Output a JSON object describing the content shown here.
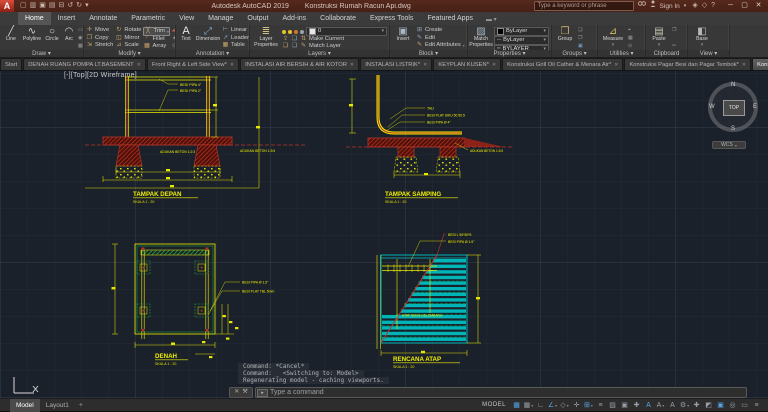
{
  "title_bar": {
    "logo": "A",
    "app": "Autodesk AutoCAD 2019",
    "doc": "Konstruksi Rumah Racun Api.dwg",
    "search_placeholder": "Type a keyword or phrase",
    "sign_in": "Sign In",
    "qat": [
      {
        "name": "new-icon",
        "glyph": "▢"
      },
      {
        "name": "open-icon",
        "glyph": "▥"
      },
      {
        "name": "save-icon",
        "glyph": "▣"
      },
      {
        "name": "save-as-icon",
        "glyph": "▤"
      },
      {
        "name": "plot-icon",
        "glyph": "⊟"
      },
      {
        "name": "undo-icon",
        "glyph": "↺"
      },
      {
        "name": "redo-icon",
        "glyph": "↻"
      },
      {
        "name": "qat-dropdown-icon",
        "glyph": "▾"
      }
    ],
    "extra_icons": [
      {
        "name": "keep-me-updated-icon",
        "glyph": "◈"
      },
      {
        "name": "app-store-icon",
        "glyph": "◇"
      },
      {
        "name": "help-icon",
        "glyph": "?"
      }
    ],
    "window": {
      "min": "─",
      "max": "▢",
      "close": "✕"
    }
  },
  "ribbon": {
    "active_tab": "Home",
    "tabs": [
      "Home",
      "Insert",
      "Annotate",
      "Parametric",
      "View",
      "Manage",
      "Output",
      "Add-ins",
      "Collaborate",
      "Express Tools",
      "Featured Apps"
    ],
    "panels": {
      "draw": {
        "name": "Draw",
        "tools": [
          "Line",
          "Polyline",
          "Circle",
          "Arc"
        ]
      },
      "modify": {
        "name": "Modify",
        "tools": [
          "Move",
          "Rotate",
          "Trim",
          "Copy",
          "Mirror",
          "Fillet",
          "Stretch",
          "Scale",
          "Array"
        ]
      },
      "annotation": {
        "name": "Annotation",
        "tools": [
          "Text",
          "Dimension",
          "Linear",
          "Leader",
          "Table"
        ]
      },
      "layers": {
        "name": "Layers",
        "big": "Layer Properties",
        "layer_value": "0",
        "tools": [
          "Make Current",
          "Match Layer"
        ]
      },
      "block": {
        "name": "Block",
        "big": "Insert",
        "tools": [
          "Create",
          "Edit",
          "Edit Attributes"
        ]
      },
      "properties": {
        "name": "Properties",
        "big": "Match Properties",
        "dropdowns": [
          "ByLayer",
          "ByLayer",
          "BYLAYER"
        ]
      },
      "groups": {
        "name": "Groups",
        "big": "Group"
      },
      "utilities": {
        "name": "Utilities",
        "big": "Measure"
      },
      "clipboard": {
        "name": "Clipboard",
        "big": "Paste"
      },
      "view": {
        "name": "View",
        "big": "Base"
      }
    }
  },
  "file_tabs": {
    "tabs": [
      {
        "label": "Start",
        "active": false
      },
      {
        "label": "DENAH RUANG POMPA LT.BASEMENT",
        "active": false
      },
      {
        "label": "Front Right & Left Side View*",
        "active": false
      },
      {
        "label": "INSTALASI AIR BERSIH & AIR KOTOR",
        "active": false
      },
      {
        "label": "INSTALASI LISTRIK*",
        "active": false
      },
      {
        "label": "KEYPLAN KUSEN*",
        "active": false
      },
      {
        "label": "Konstruksi Grill Oil Cather & Menara Air*",
        "active": false
      },
      {
        "label": "Konstruksi Pagar Besi dan Pagar Tembok*",
        "active": false
      },
      {
        "label": "Konstruksi Rumah Racun Api*",
        "active": true
      }
    ]
  },
  "canvas": {
    "viewport_label": "[-][Top][2D Wireframe]",
    "viewcube": {
      "north": "N",
      "south": "S",
      "east": "E",
      "west": "W",
      "face": "TOP",
      "wcs": "WCS"
    },
    "drawings": {
      "tampak_depan": {
        "title": "TAMPAK DEPAN",
        "scale": "SKALA 1 : 20",
        "ann1": "BESI PIPA 4\"",
        "ann2": "BESI PIPA 2\"",
        "ann3": "ADUKAN BETON 1:2:3",
        "ann4": "ADUKAN BETON 1:3:5"
      },
      "tampak_samping": {
        "title": "TAMPAK SAMPING",
        "scale": "SKALA 1 : 20",
        "ann1": "TALI",
        "ann2": "BESI PLAT SIKU 50.50.5",
        "ann3": "BESI PIPA Ø 4\"",
        "ann4": "ADUKAN BETON 1:3:5"
      },
      "denah": {
        "title": "DENAH",
        "scale": "SKALA 1 : 20",
        "ann1": "BESI PIPA Ø 1.5\"",
        "ann2": "BESI PLAT TBL 5mm"
      },
      "rencana_atap": {
        "title": "RENCANA ATAP",
        "scale": "SKALA 1 : 20",
        "ann1": "BESI L 50*50*5",
        "ann2": "BESI PIPA Ø 1.5\"",
        "ann3": "ATAP SENG GELOMBANG"
      }
    }
  },
  "command": {
    "history": [
      "Command: *Cancel*",
      "Command: _ <Switching to: Model>",
      "Regenerating model - caching viewports."
    ],
    "prompt": "Type a command"
  },
  "status_bar": {
    "model_tab": "Model",
    "layout_tab": "Layout1",
    "plus": "+",
    "mode_label": "MODEL",
    "icons": [
      {
        "name": "grid-icon",
        "glyph": "▦",
        "blue": true,
        "dd": false
      },
      {
        "name": "snap-mode-icon",
        "glyph": "▦",
        "blue": false,
        "dd": true
      },
      {
        "name": "ortho-icon",
        "glyph": "∟",
        "blue": false,
        "dd": false
      },
      {
        "name": "polar-tracking-icon",
        "glyph": "∠",
        "blue": true,
        "dd": true
      },
      {
        "name": "isometric-drafting-icon",
        "glyph": "◇",
        "blue": false,
        "dd": true
      },
      {
        "name": "object-snap-tracking-icon",
        "glyph": "✛",
        "blue": false,
        "dd": false
      },
      {
        "name": "object-snap-icon",
        "glyph": "⊞",
        "blue": true,
        "dd": true
      },
      {
        "name": "lineweight-icon",
        "glyph": "≡",
        "blue": false,
        "dd": false
      },
      {
        "name": "transparency-icon",
        "glyph": "▨",
        "blue": false,
        "dd": false
      },
      {
        "name": "selection-cycling-icon",
        "glyph": "▣",
        "blue": false,
        "dd": false
      },
      {
        "name": "dynamic-input-icon",
        "glyph": "✚",
        "blue": false,
        "dd": false
      },
      {
        "name": "annotation-visibility-icon",
        "glyph": "A",
        "blue": true,
        "dd": false
      },
      {
        "name": "annotation-autoscale-icon",
        "glyph": "A",
        "blue": false,
        "dd": true
      },
      {
        "name": "annotation-scale-icon",
        "glyph": "A",
        "blue": false,
        "dd": false
      },
      {
        "name": "workspace-icon",
        "glyph": "⚙",
        "blue": false,
        "dd": true
      },
      {
        "name": "annotation-monitor-icon",
        "glyph": "✚",
        "blue": false,
        "dd": false
      },
      {
        "name": "quick-properties-icon",
        "glyph": "◩",
        "blue": false,
        "dd": false
      },
      {
        "name": "hardware-acceleration-icon",
        "glyph": "▣",
        "blue": true,
        "dd": false
      },
      {
        "name": "isolate-objects-icon",
        "glyph": "◎",
        "blue": false,
        "dd": false
      },
      {
        "name": "clean-screen-icon",
        "glyph": "▭",
        "blue": false,
        "dd": false
      },
      {
        "name": "customization-icon",
        "glyph": "≡",
        "blue": false,
        "dd": false
      }
    ]
  }
}
